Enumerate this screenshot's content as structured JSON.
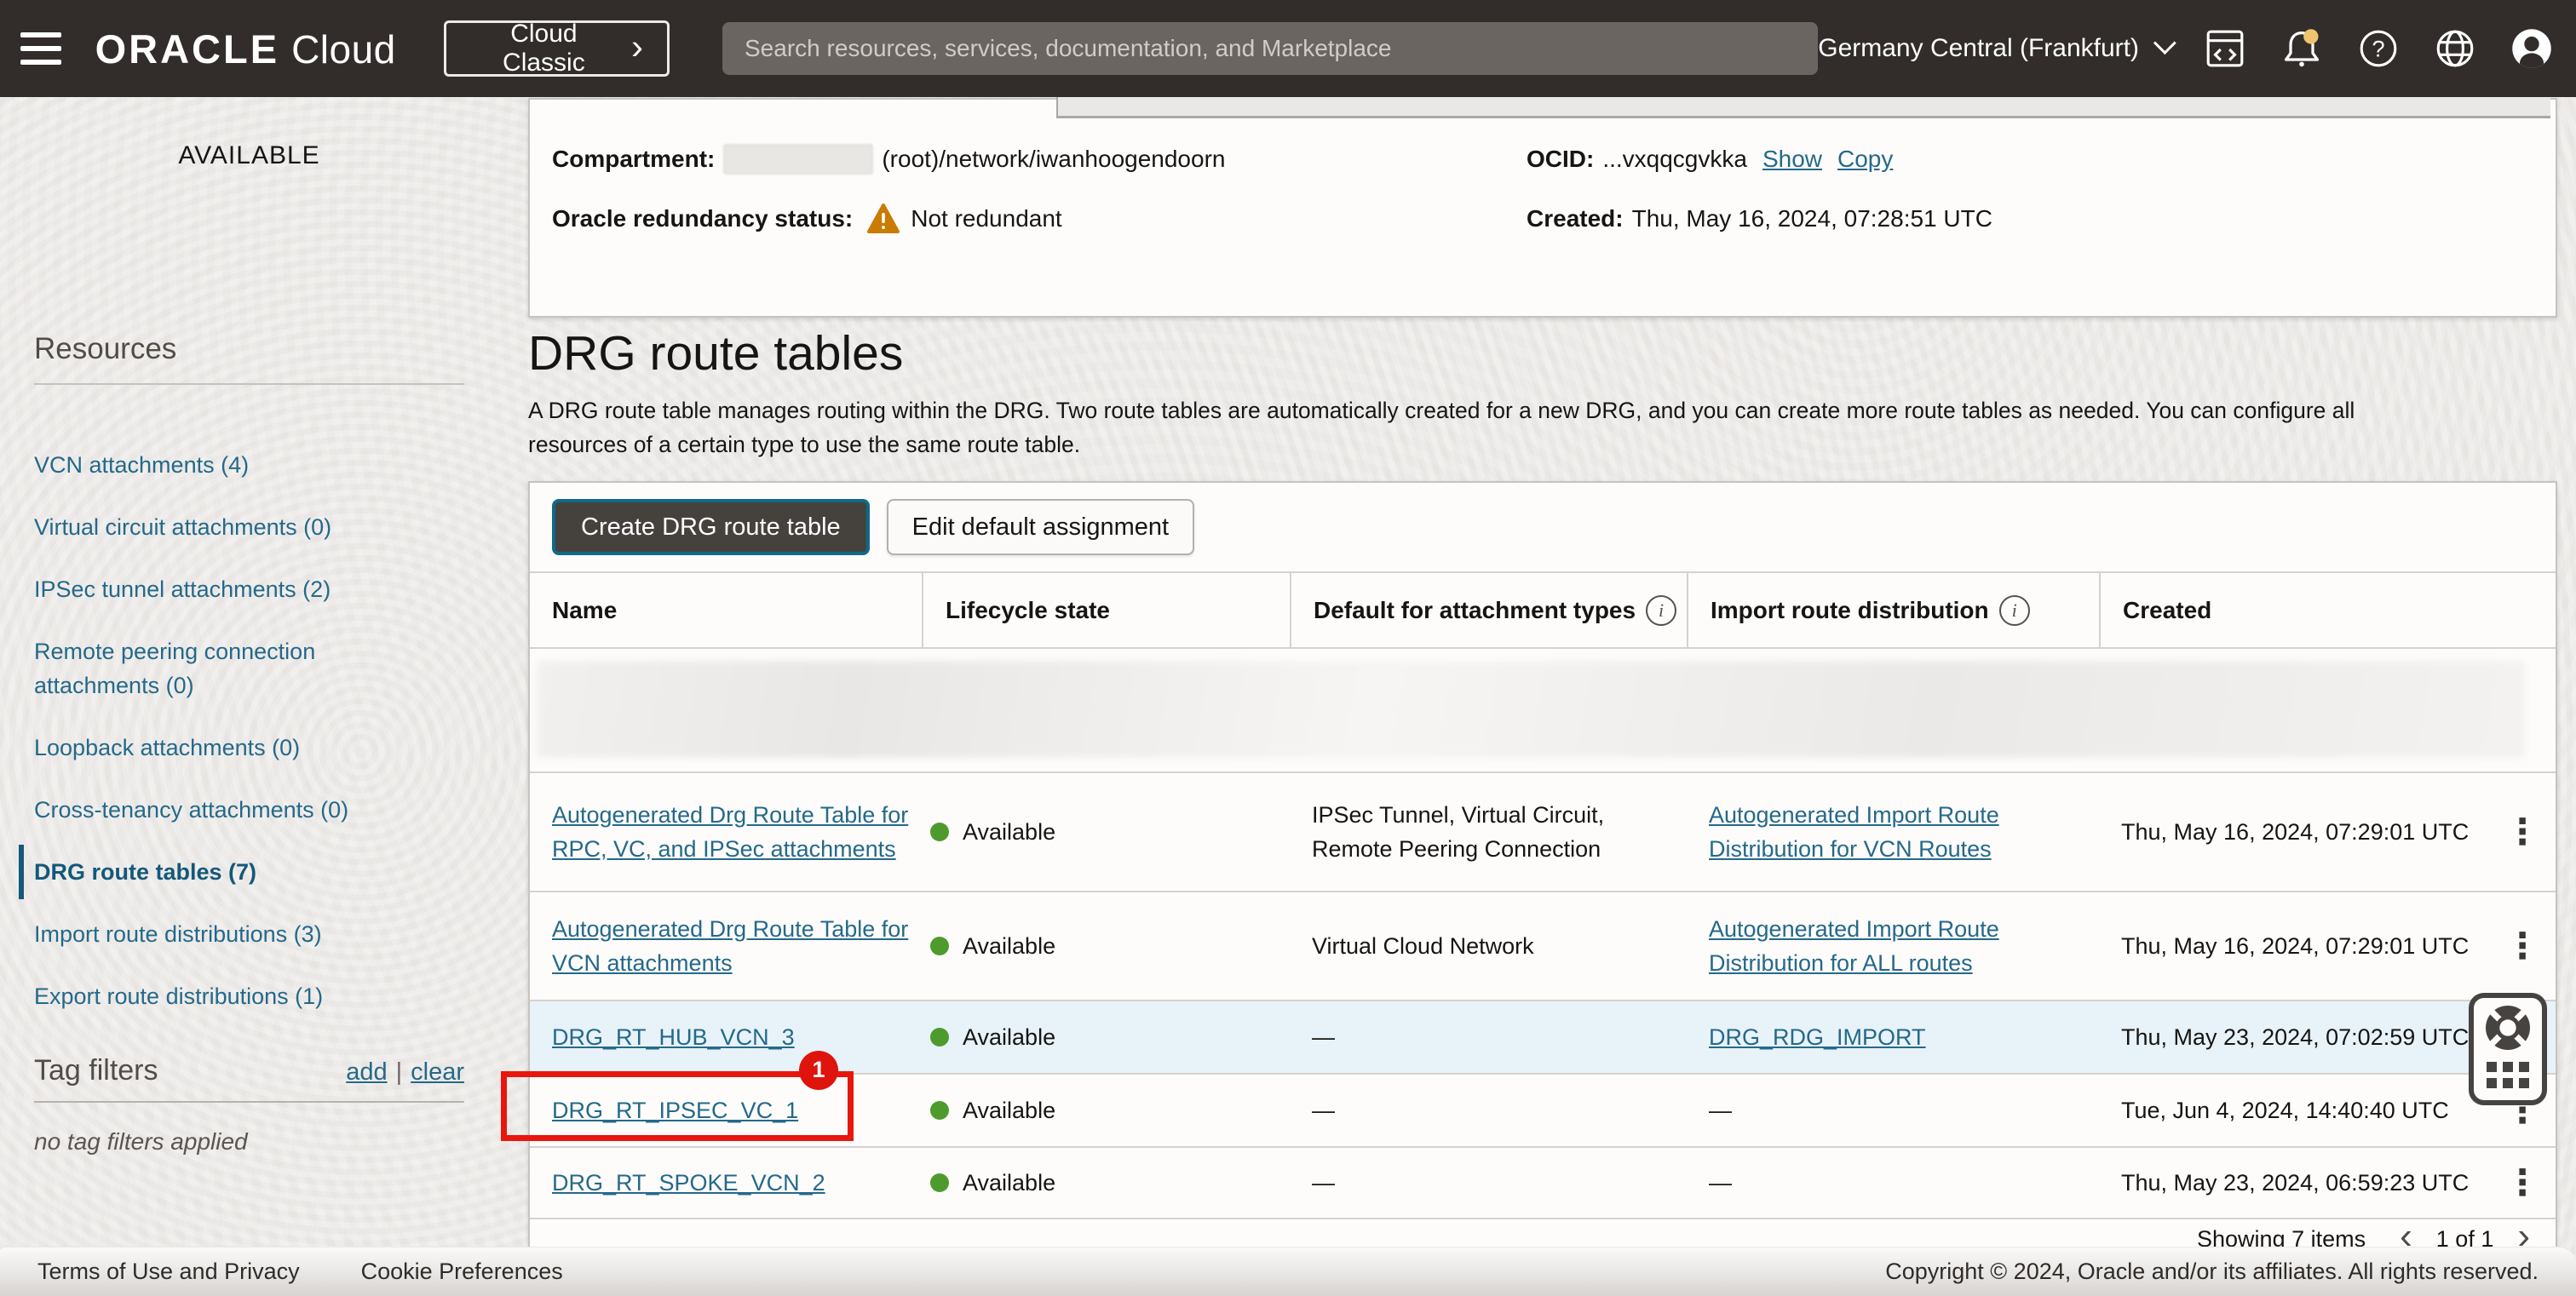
{
  "topbar": {
    "logo_primary": "ORACLE",
    "logo_secondary": "Cloud",
    "classic_button_label": "Cloud Classic",
    "classic_button_chevron": "›",
    "search_placeholder": "Search resources, services, documentation, and Marketplace",
    "region_label": "Germany Central (Frankfurt)"
  },
  "sidebar": {
    "status_text": "AVAILABLE",
    "resources_title": "Resources",
    "items": [
      {
        "label": "VCN attachments (4)",
        "active": false
      },
      {
        "label": "Virtual circuit attachments (0)",
        "active": false
      },
      {
        "label": "IPSec tunnel attachments (2)",
        "active": false
      },
      {
        "label": "Remote peering connection attachments (0)",
        "active": false
      },
      {
        "label": "Loopback attachments (0)",
        "active": false
      },
      {
        "label": "Cross-tenancy attachments (0)",
        "active": false
      },
      {
        "label": "DRG route tables (7)",
        "active": true
      },
      {
        "label": "Import route distributions (3)",
        "active": false
      },
      {
        "label": "Export route distributions (1)",
        "active": false
      }
    ],
    "tag_filters": {
      "title": "Tag filters",
      "add_link": "add",
      "separator": "|",
      "clear_link": "clear",
      "empty_text": "no tag filters applied"
    }
  },
  "details": {
    "compartment_label": "Compartment:",
    "compartment_value": "(root)/network/iwanhoogendoorn",
    "redundancy_label": "Oracle redundancy status:",
    "redundancy_value": "Not redundant",
    "ocid_label": "OCID:",
    "ocid_value": "...vxqqcgvkka",
    "show_link": "Show",
    "copy_link": "Copy",
    "created_label": "Created:",
    "created_value": "Thu, May 16, 2024, 07:28:51 UTC"
  },
  "section": {
    "title": "DRG route tables",
    "description_lines": [
      "A DRG route table manages routing within the DRG. Two route tables are automatically created for a new DRG, and you can create more route tables as needed. You can configure all",
      "resources of a certain type to use the same route table."
    ],
    "create_button": "Create DRG route table",
    "edit_button": "Edit default assignment"
  },
  "table": {
    "columns": [
      "Name",
      "Lifecycle state",
      "Default for attachment types",
      "Import route distribution",
      "Created"
    ],
    "info_glyph": "i",
    "kebab_glyph": "⋮",
    "rows": [
      {
        "name_lines": [
          "Autogenerated Drg Route Table for",
          "RPC, VC, and IPSec attachments"
        ],
        "state": "Available",
        "default_lines": [
          "IPSec Tunnel, Virtual Circuit,",
          "Remote Peering Connection"
        ],
        "import_lines": [
          "Autogenerated Import Route",
          "Distribution for VCN Routes"
        ],
        "import_is_link": true,
        "created": "Thu, May 16, 2024, 07:29:01 UTC",
        "highlighted": false,
        "annotated": false
      },
      {
        "name_lines": [
          "Autogenerated Drg Route Table for",
          "VCN attachments"
        ],
        "state": "Available",
        "default_lines": [
          "Virtual Cloud Network"
        ],
        "import_lines": [
          "Autogenerated Import Route",
          "Distribution for ALL routes"
        ],
        "import_is_link": true,
        "created": "Thu, May 16, 2024, 07:29:01 UTC",
        "highlighted": false,
        "annotated": false
      },
      {
        "name_lines": [
          "DRG_RT_HUB_VCN_3"
        ],
        "state": "Available",
        "default_lines": [
          "—"
        ],
        "import_lines": [
          "DRG_RDG_IMPORT"
        ],
        "import_is_link": true,
        "created": "Thu, May 23, 2024, 07:02:59 UTC",
        "highlighted": true,
        "annotated": false
      },
      {
        "name_lines": [
          "DRG_RT_IPSEC_VC_1"
        ],
        "state": "Available",
        "default_lines": [
          "—"
        ],
        "import_lines": [
          "—"
        ],
        "import_is_link": false,
        "created": "Tue, Jun 4, 2024, 14:40:40 UTC",
        "highlighted": false,
        "annotated": true,
        "annotation_badge": "1"
      },
      {
        "name_lines": [
          "DRG_RT_SPOKE_VCN_2"
        ],
        "state": "Available",
        "default_lines": [
          "—"
        ],
        "import_lines": [
          "—"
        ],
        "import_is_link": false,
        "created": "Thu, May 23, 2024, 06:59:23 UTC",
        "highlighted": false,
        "annotated": false
      }
    ],
    "pagination": {
      "showing_text": "Showing 7 items",
      "prev_glyph": "‹",
      "page_text": "1 of 1",
      "next_glyph": "›"
    }
  },
  "footer": {
    "terms_link": "Terms of Use and Privacy",
    "cookie_link": "Cookie Preferences",
    "copyright": "Copyright © 2024, Oracle and/or its affiliates. All rights reserved."
  },
  "colors": {
    "topbar_bg": "#322d2a",
    "link_teal": "#24698a",
    "active_nav_teal": "#14587a",
    "available_green": "#4e9b2d",
    "warning_orange": "#c97b02",
    "annotation_red": "#e8170e",
    "row_highlight_blue": "#e8f2f9",
    "notification_yellow": "#eec46f"
  }
}
